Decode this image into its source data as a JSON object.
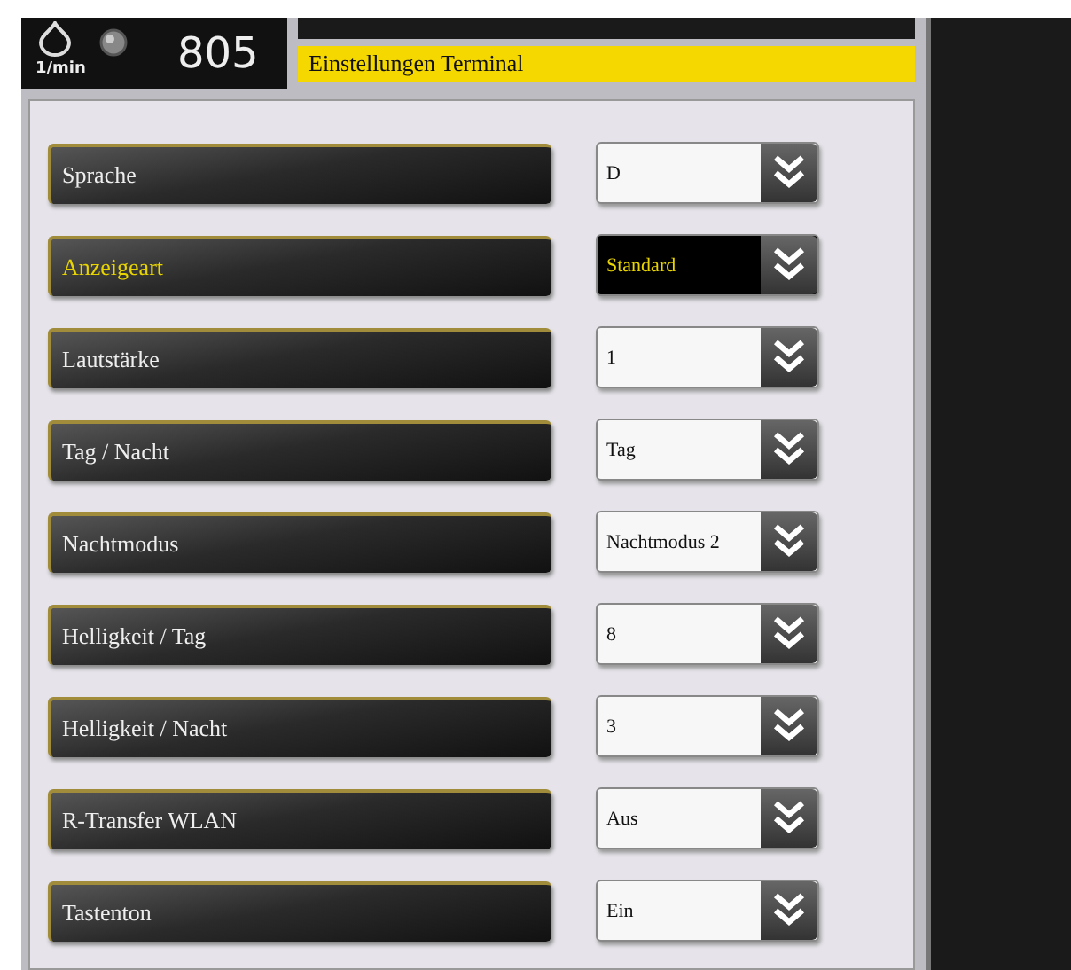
{
  "header": {
    "speed_value": "805",
    "speed_unit": "1/min",
    "title": "Einstellungen Terminal"
  },
  "settings": [
    {
      "label": "Sprache",
      "value": "D",
      "selected": false
    },
    {
      "label": "Anzeigeart",
      "value": "Standard",
      "selected": true
    },
    {
      "label": "Lautstärke",
      "value": "1",
      "selected": false
    },
    {
      "label": "Tag / Nacht",
      "value": "Tag",
      "selected": false
    },
    {
      "label": "Nachtmodus",
      "value": "Nachtmodus 2",
      "selected": false
    },
    {
      "label": "Helligkeit / Tag",
      "value": "8",
      "selected": false
    },
    {
      "label": "Helligkeit / Nacht",
      "value": "3",
      "selected": false
    },
    {
      "label": "R-Transfer WLAN",
      "value": "Aus",
      "selected": false
    },
    {
      "label": "Tastenton",
      "value": "Ein",
      "selected": false
    }
  ]
}
